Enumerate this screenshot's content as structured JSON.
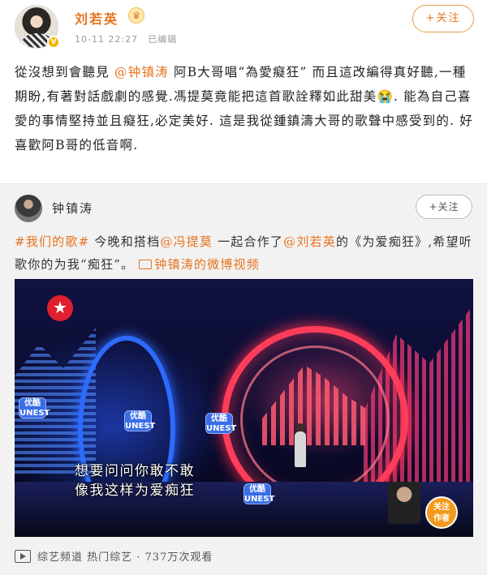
{
  "post": {
    "username": "刘若英",
    "time": "10-11 22:27",
    "edited": "已编辑",
    "follow_label": "+关注",
    "mention": "@钟镇涛",
    "text_1": "從沒想到會聽見",
    "text_2": "阿B大哥唱“為愛癡狂” 而且這改編得真好聽,一種期盼,有著對話戲劇的感覺.馮提莫竟能把這首歌詮釋如此甜美",
    "emoji": "😭",
    "text_3": ". 能為自己喜愛的事情堅持並且癡狂,必定美好. 這是我從鍾鎮濤大哥的歌聲中感受到的. 好喜歡阿B哥的低音啊."
  },
  "repost": {
    "username": "钟镇涛",
    "follow_label": "+关注",
    "hashtag": "#我们的歌#",
    "text_1": "今晚和搭档",
    "mention_1": "@冯提莫",
    "text_2": "一起合作了",
    "mention_2": "@刘若英",
    "text_3": "的《为爱痴狂》,希望听歌你的为我“痴狂”。",
    "video_link": "钟镇涛的微博视频"
  },
  "video": {
    "subtitle_1": "想要问问你敢不敢",
    "subtitle_2": "像我这样为爱痴狂",
    "sponsor": "优酷\nUNEST",
    "follow_author": "关注\n作者"
  },
  "footer": {
    "text": "综艺频道 热门综艺 · 737万次观看"
  },
  "icons": {
    "verified": "verified-badge-icon",
    "crown": "crown-icon",
    "video": "video-icon",
    "play": "play-icon"
  },
  "colors": {
    "accent": "#e8721c",
    "repost_bg": "#f2f2f2"
  }
}
